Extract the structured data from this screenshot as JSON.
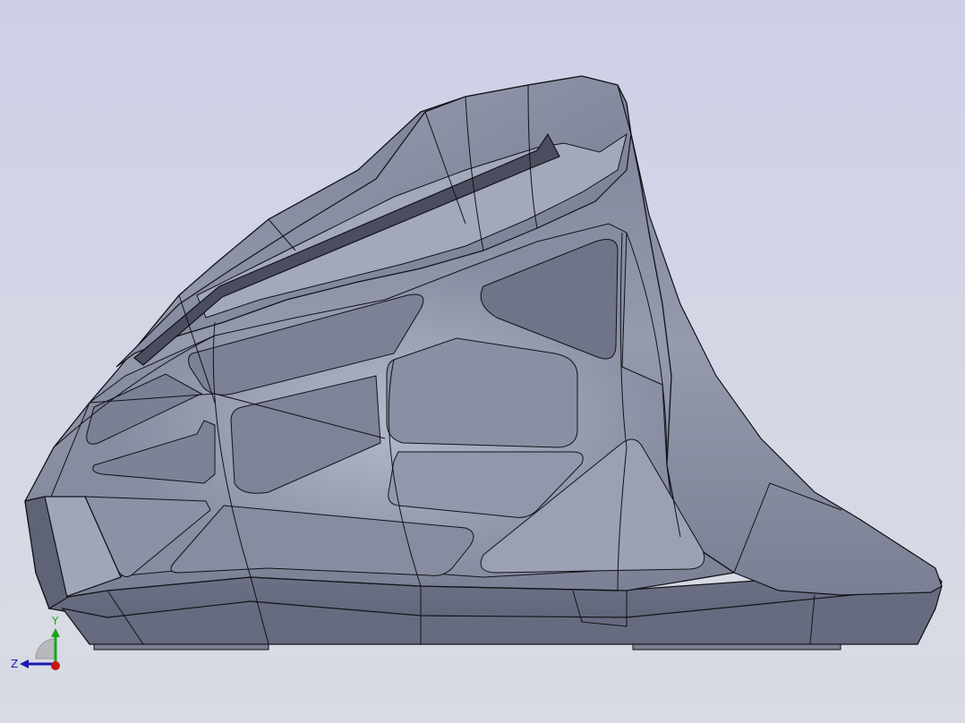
{
  "viewport": {
    "background_top": "#cdcfe6",
    "background_bottom": "#d9dbe3"
  },
  "model": {
    "body_color": "#8e93a6",
    "edge_color": "#111318"
  },
  "triad": {
    "y_label": "Y",
    "z_label": "Z",
    "y_color": "#1aa51a",
    "z_color": "#1a1ab4",
    "x_color": "#c81414"
  }
}
